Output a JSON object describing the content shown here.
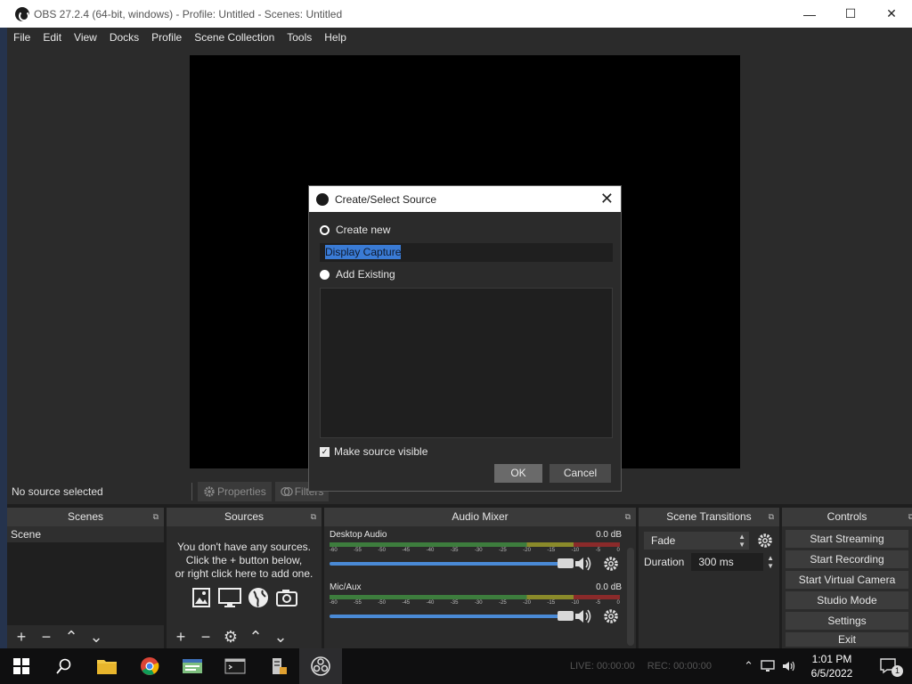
{
  "window": {
    "title": "OBS 27.2.4 (64-bit, windows) - Profile: Untitled - Scenes: Untitled",
    "minimize": "—",
    "maximize": "☐",
    "close": "✕"
  },
  "menu": [
    "File",
    "Edit",
    "View",
    "Docks",
    "Profile",
    "Scene Collection",
    "Tools",
    "Help"
  ],
  "props_bar": {
    "no_source": "No source selected",
    "properties": "Properties",
    "filters": "Filters"
  },
  "docks": {
    "scenes": {
      "title": "Scenes",
      "items": [
        "Scene"
      ]
    },
    "sources": {
      "title": "Sources",
      "empty_lines": [
        "You don't have any sources.",
        "Click the + button below,",
        "or right click here to add one."
      ]
    },
    "mixer": {
      "title": "Audio Mixer",
      "channels": [
        {
          "name": "Desktop Audio",
          "db": "0.0 dB",
          "level": 0.97
        },
        {
          "name": "Mic/Aux",
          "db": "0.0 dB",
          "level": 0.97
        }
      ],
      "ticks": [
        "-60",
        "-55",
        "-50",
        "-45",
        "-40",
        "-35",
        "-30",
        "-25",
        "-20",
        "-15",
        "-10",
        "-5",
        "0"
      ]
    },
    "transitions": {
      "title": "Scene Transitions",
      "selected": "Fade",
      "duration_label": "Duration",
      "duration_value": "300 ms"
    },
    "controls": {
      "title": "Controls",
      "buttons": [
        "Start Streaming",
        "Start Recording",
        "Start Virtual Camera",
        "Studio Mode",
        "Settings",
        "Exit"
      ]
    }
  },
  "dialog": {
    "title": "Create/Select Source",
    "create_new": "Create new",
    "name_value": "Display Capture",
    "add_existing": "Add Existing",
    "make_visible": "Make source visible",
    "ok": "OK",
    "cancel": "Cancel"
  },
  "taskbar": {
    "live": "LIVE: 00:00:00",
    "rec": "REC: 00:00:00",
    "time": "1:01 PM",
    "date": "6/5/2022",
    "notifications": "1"
  }
}
